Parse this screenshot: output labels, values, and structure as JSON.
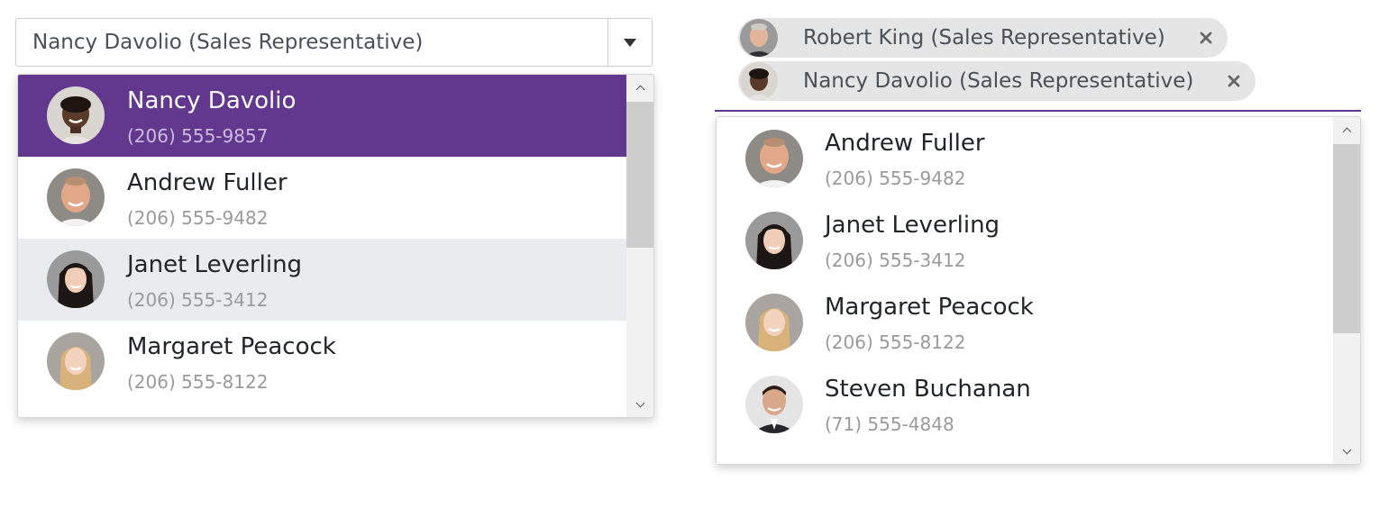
{
  "combobox": {
    "value": "Nancy Davolio (Sales Representative)",
    "arrow_icon": "caret-down-icon",
    "items": [
      {
        "name": "Nancy Davolio",
        "phone": "(206) 555-9857",
        "state": "selected"
      },
      {
        "name": "Andrew Fuller",
        "phone": "(206) 555-9482",
        "state": "normal"
      },
      {
        "name": "Janet Leverling",
        "phone": "(206) 555-3412",
        "state": "hover"
      },
      {
        "name": "Margaret Peacock",
        "phone": "(206) 555-8122",
        "state": "normal"
      }
    ]
  },
  "multiselect": {
    "chips": [
      {
        "label": "Robert King (Sales Representative)",
        "remove_icon": "close-icon"
      },
      {
        "label": "Nancy Davolio (Sales Representative)",
        "remove_icon": "close-icon"
      }
    ],
    "items": [
      {
        "name": "Andrew Fuller",
        "phone": "(206) 555-9482"
      },
      {
        "name": "Janet Leverling",
        "phone": "(206) 555-3412"
      },
      {
        "name": "Margaret Peacock",
        "phone": "(206) 555-8122"
      },
      {
        "name": "Steven Buchanan",
        "phone": "(71) 555-4848"
      }
    ]
  },
  "colors": {
    "accent": "#62388f",
    "hover": "#e9ecef",
    "chip": "#e5e5e5",
    "secondary_text": "#9a9a9a"
  }
}
